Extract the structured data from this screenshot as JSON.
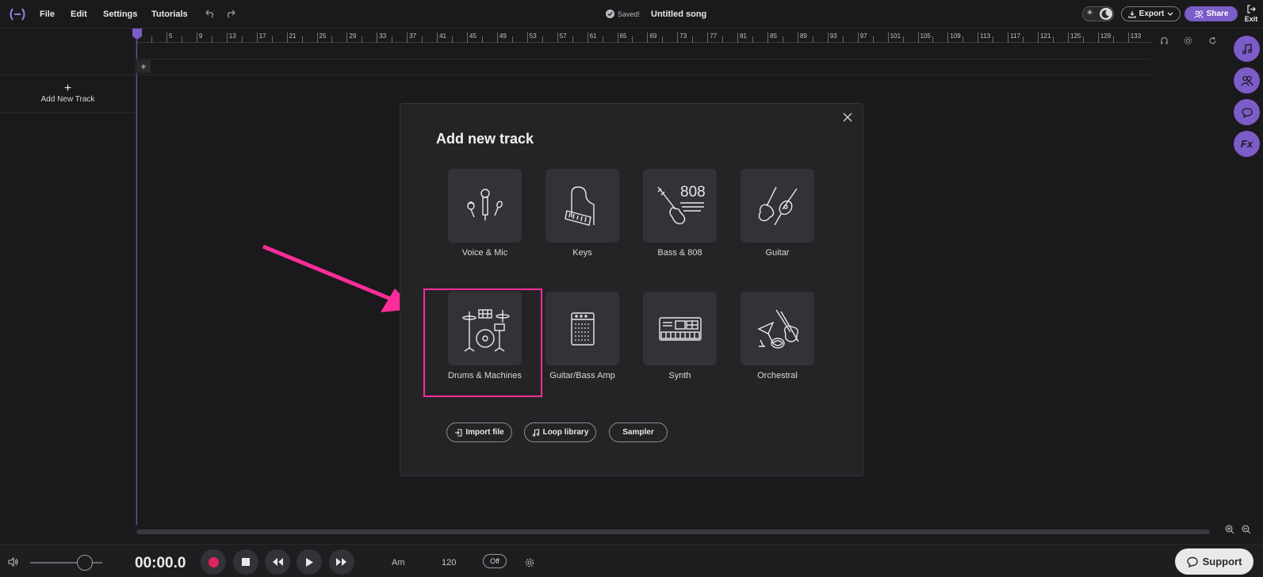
{
  "topbar": {
    "menu": [
      {
        "label": "File"
      },
      {
        "label": "Edit"
      },
      {
        "label": "Settings"
      },
      {
        "label": "Tutorials"
      }
    ],
    "saved_label": "Saved!",
    "song_title": "Untitled song",
    "export_label": "Export",
    "share_label": "Share",
    "exit_label": "Exit"
  },
  "ruler": {
    "ticks": [
      "5",
      "9",
      "13",
      "17",
      "21",
      "25",
      "29",
      "33",
      "37",
      "41",
      "45",
      "49",
      "53",
      "57",
      "61",
      "65",
      "69",
      "73",
      "77",
      "81",
      "85",
      "89",
      "93",
      "97",
      "101",
      "105",
      "109",
      "113",
      "117",
      "121",
      "125",
      "129",
      "133"
    ]
  },
  "tracks": {
    "add_new_track_label": "Add New Track",
    "lane_add_label": "+"
  },
  "modal": {
    "title": "Add new track",
    "instruments": [
      {
        "label": "Voice & Mic",
        "icon": "microphone-icon"
      },
      {
        "label": "Keys",
        "icon": "piano-icon"
      },
      {
        "label": "Bass & 808",
        "icon": "bass-808-icon"
      },
      {
        "label": "Guitar",
        "icon": "guitar-icon"
      },
      {
        "label": "Drums & Machines",
        "icon": "drum-kit-icon"
      },
      {
        "label": "Guitar/Bass Amp",
        "icon": "amp-icon"
      },
      {
        "label": "Synth",
        "icon": "synth-icon"
      },
      {
        "label": "Orchestral",
        "icon": "orchestral-icon"
      }
    ],
    "bass_tile_text": "808",
    "actions": {
      "import_label": "Import file",
      "loop_label": "Loop library",
      "sampler_label": "Sampler"
    }
  },
  "transport": {
    "time": "00:00.0",
    "key": "Am",
    "bpm": "120",
    "metronome": "Off"
  },
  "support_label": "Support",
  "sidebar": {
    "fx_label": "Fx"
  },
  "colors": {
    "accent": "#7b5cc8",
    "highlight": "#ff2d9a",
    "record": "#e0245e",
    "background": "#1a1a1c"
  }
}
